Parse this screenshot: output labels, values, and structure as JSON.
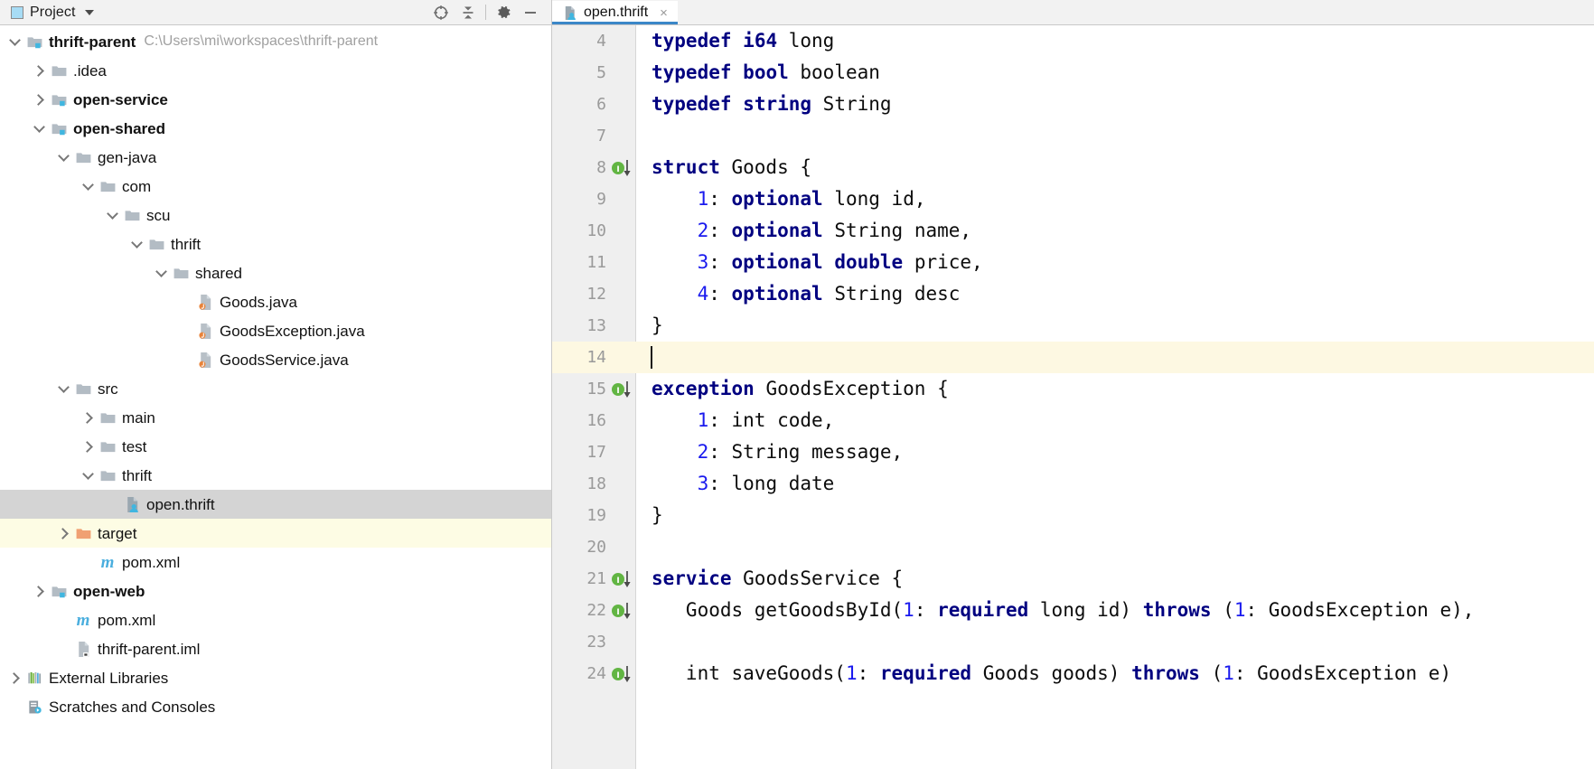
{
  "toolwindow": {
    "title": "Project",
    "icons": [
      {
        "name": "locate-icon",
        "glyph": "crosshair"
      },
      {
        "name": "collapse-all-icon",
        "glyph": "collapse"
      },
      {
        "name": "settings-gear-icon",
        "glyph": "gear"
      },
      {
        "name": "hide-window-icon",
        "glyph": "minimize"
      }
    ]
  },
  "editor_tabs": [
    {
      "label": "open.thrift",
      "icon": "thrift-file-icon",
      "active": true,
      "close": "×"
    }
  ],
  "tree": [
    {
      "depth": 0,
      "arrow": "down",
      "icon": "module-folder",
      "label": "thrift-parent",
      "bold": true,
      "path": "C:\\Users\\mi\\workspaces\\thrift-parent",
      "state": "normal"
    },
    {
      "depth": 1,
      "arrow": "right",
      "icon": "folder",
      "label": ".idea",
      "bold": false,
      "path": "",
      "state": "normal"
    },
    {
      "depth": 1,
      "arrow": "right",
      "icon": "module-folder",
      "label": "open-service",
      "bold": true,
      "path": "",
      "state": "normal"
    },
    {
      "depth": 1,
      "arrow": "down",
      "icon": "module-folder",
      "label": "open-shared",
      "bold": true,
      "path": "",
      "state": "normal"
    },
    {
      "depth": 2,
      "arrow": "down",
      "icon": "folder",
      "label": "gen-java",
      "bold": false,
      "path": "",
      "state": "normal"
    },
    {
      "depth": 3,
      "arrow": "down",
      "icon": "folder",
      "label": "com",
      "bold": false,
      "path": "",
      "state": "normal"
    },
    {
      "depth": 4,
      "arrow": "down",
      "icon": "folder",
      "label": "scu",
      "bold": false,
      "path": "",
      "state": "normal"
    },
    {
      "depth": 5,
      "arrow": "down",
      "icon": "folder",
      "label": "thrift",
      "bold": false,
      "path": "",
      "state": "normal"
    },
    {
      "depth": 6,
      "arrow": "down",
      "icon": "folder",
      "label": "shared",
      "bold": false,
      "path": "",
      "state": "normal"
    },
    {
      "depth": 7,
      "arrow": "none",
      "icon": "java-file",
      "label": "Goods.java",
      "bold": false,
      "path": "",
      "state": "normal"
    },
    {
      "depth": 7,
      "arrow": "none",
      "icon": "java-file",
      "label": "GoodsException.java",
      "bold": false,
      "path": "",
      "state": "normal"
    },
    {
      "depth": 7,
      "arrow": "none",
      "icon": "java-file",
      "label": "GoodsService.java",
      "bold": false,
      "path": "",
      "state": "normal"
    },
    {
      "depth": 2,
      "arrow": "down",
      "icon": "folder",
      "label": "src",
      "bold": false,
      "path": "",
      "state": "normal"
    },
    {
      "depth": 3,
      "arrow": "right",
      "icon": "folder",
      "label": "main",
      "bold": false,
      "path": "",
      "state": "normal"
    },
    {
      "depth": 3,
      "arrow": "right",
      "icon": "folder",
      "label": "test",
      "bold": false,
      "path": "",
      "state": "normal"
    },
    {
      "depth": 3,
      "arrow": "down",
      "icon": "folder",
      "label": "thrift",
      "bold": false,
      "path": "",
      "state": "normal"
    },
    {
      "depth": 4,
      "arrow": "none",
      "icon": "thrift-file",
      "label": "open.thrift",
      "bold": false,
      "path": "",
      "state": "selected"
    },
    {
      "depth": 2,
      "arrow": "right",
      "icon": "folder-orange",
      "label": "target",
      "bold": false,
      "path": "",
      "state": "excluded"
    },
    {
      "depth": 3,
      "arrow": "none",
      "icon": "maven-file",
      "label": "pom.xml",
      "bold": false,
      "path": "",
      "state": "normal"
    },
    {
      "depth": 1,
      "arrow": "right",
      "icon": "module-folder",
      "label": "open-web",
      "bold": true,
      "path": "",
      "state": "normal"
    },
    {
      "depth": 2,
      "arrow": "none",
      "icon": "maven-file",
      "label": "pom.xml",
      "bold": false,
      "path": "",
      "state": "normal"
    },
    {
      "depth": 2,
      "arrow": "none",
      "icon": "iml-file",
      "label": "thrift-parent.iml",
      "bold": false,
      "path": "",
      "state": "normal"
    },
    {
      "depth": 0,
      "arrow": "right",
      "icon": "libraries",
      "label": "External Libraries",
      "bold": false,
      "path": "",
      "state": "normal"
    },
    {
      "depth": 0,
      "arrow": "none",
      "icon": "scratches",
      "label": "Scratches and Consoles",
      "bold": false,
      "path": "",
      "state": "normal"
    }
  ],
  "code": {
    "first_visible_line": 4,
    "lines": [
      {
        "num": "4",
        "gutter": "",
        "caret": false,
        "tokens": [
          {
            "t": "typedef",
            "c": "kw"
          },
          {
            "t": " ",
            "c": ""
          },
          {
            "t": "i64",
            "c": "kw"
          },
          {
            "t": " long",
            "c": ""
          }
        ]
      },
      {
        "num": "5",
        "gutter": "",
        "caret": false,
        "tokens": [
          {
            "t": "typedef",
            "c": "kw"
          },
          {
            "t": " ",
            "c": ""
          },
          {
            "t": "bool",
            "c": "kw"
          },
          {
            "t": " boolean",
            "c": ""
          }
        ]
      },
      {
        "num": "6",
        "gutter": "",
        "caret": false,
        "tokens": [
          {
            "t": "typedef",
            "c": "kw"
          },
          {
            "t": " ",
            "c": ""
          },
          {
            "t": "string",
            "c": "kw"
          },
          {
            "t": " String",
            "c": ""
          }
        ]
      },
      {
        "num": "7",
        "gutter": "",
        "caret": false,
        "tokens": []
      },
      {
        "num": "8",
        "gutter": "impl-down",
        "caret": false,
        "tokens": [
          {
            "t": "struct",
            "c": "kw"
          },
          {
            "t": " Goods {",
            "c": ""
          }
        ]
      },
      {
        "num": "9",
        "gutter": "",
        "caret": false,
        "tokens": [
          {
            "t": "    ",
            "c": ""
          },
          {
            "t": "1",
            "c": "num"
          },
          {
            "t": ": ",
            "c": ""
          },
          {
            "t": "optional",
            "c": "kw"
          },
          {
            "t": " long id,",
            "c": ""
          }
        ]
      },
      {
        "num": "10",
        "gutter": "",
        "caret": false,
        "tokens": [
          {
            "t": "    ",
            "c": ""
          },
          {
            "t": "2",
            "c": "num"
          },
          {
            "t": ": ",
            "c": ""
          },
          {
            "t": "optional",
            "c": "kw"
          },
          {
            "t": " String name,",
            "c": ""
          }
        ]
      },
      {
        "num": "11",
        "gutter": "",
        "caret": false,
        "tokens": [
          {
            "t": "    ",
            "c": ""
          },
          {
            "t": "3",
            "c": "num"
          },
          {
            "t": ": ",
            "c": ""
          },
          {
            "t": "optional",
            "c": "kw"
          },
          {
            "t": " ",
            "c": ""
          },
          {
            "t": "double",
            "c": "kw"
          },
          {
            "t": " price,",
            "c": ""
          }
        ]
      },
      {
        "num": "12",
        "gutter": "",
        "caret": false,
        "tokens": [
          {
            "t": "    ",
            "c": ""
          },
          {
            "t": "4",
            "c": "num"
          },
          {
            "t": ": ",
            "c": ""
          },
          {
            "t": "optional",
            "c": "kw"
          },
          {
            "t": " String desc",
            "c": ""
          }
        ]
      },
      {
        "num": "13",
        "gutter": "",
        "caret": false,
        "tokens": [
          {
            "t": "}",
            "c": ""
          }
        ]
      },
      {
        "num": "14",
        "gutter": "",
        "caret": true,
        "tokens": []
      },
      {
        "num": "15",
        "gutter": "impl-down",
        "caret": false,
        "tokens": [
          {
            "t": "exception",
            "c": "kw"
          },
          {
            "t": " GoodsException {",
            "c": ""
          }
        ]
      },
      {
        "num": "16",
        "gutter": "",
        "caret": false,
        "tokens": [
          {
            "t": "    ",
            "c": ""
          },
          {
            "t": "1",
            "c": "num"
          },
          {
            "t": ": int code,",
            "c": ""
          }
        ]
      },
      {
        "num": "17",
        "gutter": "",
        "caret": false,
        "tokens": [
          {
            "t": "    ",
            "c": ""
          },
          {
            "t": "2",
            "c": "num"
          },
          {
            "t": ": String message,",
            "c": ""
          }
        ]
      },
      {
        "num": "18",
        "gutter": "",
        "caret": false,
        "tokens": [
          {
            "t": "    ",
            "c": ""
          },
          {
            "t": "3",
            "c": "num"
          },
          {
            "t": ": long date",
            "c": ""
          }
        ]
      },
      {
        "num": "19",
        "gutter": "",
        "caret": false,
        "tokens": [
          {
            "t": "}",
            "c": ""
          }
        ]
      },
      {
        "num": "20",
        "gutter": "",
        "caret": false,
        "tokens": []
      },
      {
        "num": "21",
        "gutter": "impl-down",
        "caret": false,
        "tokens": [
          {
            "t": "service",
            "c": "kw"
          },
          {
            "t": " GoodsService {",
            "c": ""
          }
        ]
      },
      {
        "num": "22",
        "gutter": "impl-down",
        "caret": false,
        "tokens": [
          {
            "t": "   Goods getGoodsById(",
            "c": ""
          },
          {
            "t": "1",
            "c": "num"
          },
          {
            "t": ": ",
            "c": ""
          },
          {
            "t": "required",
            "c": "kw"
          },
          {
            "t": " long id) ",
            "c": ""
          },
          {
            "t": "throws",
            "c": "kw"
          },
          {
            "t": " (",
            "c": ""
          },
          {
            "t": "1",
            "c": "num"
          },
          {
            "t": ": GoodsException e),",
            "c": ""
          }
        ]
      },
      {
        "num": "23",
        "gutter": "",
        "caret": false,
        "tokens": []
      },
      {
        "num": "24",
        "gutter": "impl-down",
        "caret": false,
        "tokens": [
          {
            "t": "   int saveGoods(",
            "c": ""
          },
          {
            "t": "1",
            "c": "num"
          },
          {
            "t": ": ",
            "c": ""
          },
          {
            "t": "required",
            "c": "kw"
          },
          {
            "t": " Goods goods) ",
            "c": ""
          },
          {
            "t": "throws",
            "c": "kw"
          },
          {
            "t": " (",
            "c": ""
          },
          {
            "t": "1",
            "c": "num"
          },
          {
            "t": ": GoodsException e)",
            "c": ""
          }
        ]
      }
    ]
  },
  "colors": {
    "keyword": "#000080",
    "number": "#1a1aee",
    "tab_underline": "#3b87c8",
    "selection": "#d4d4d4",
    "excluded": "#fdfce4",
    "caret_line": "#fdf8e2",
    "gutter_bg": "#efefef",
    "impl_marker": "#62b543"
  }
}
